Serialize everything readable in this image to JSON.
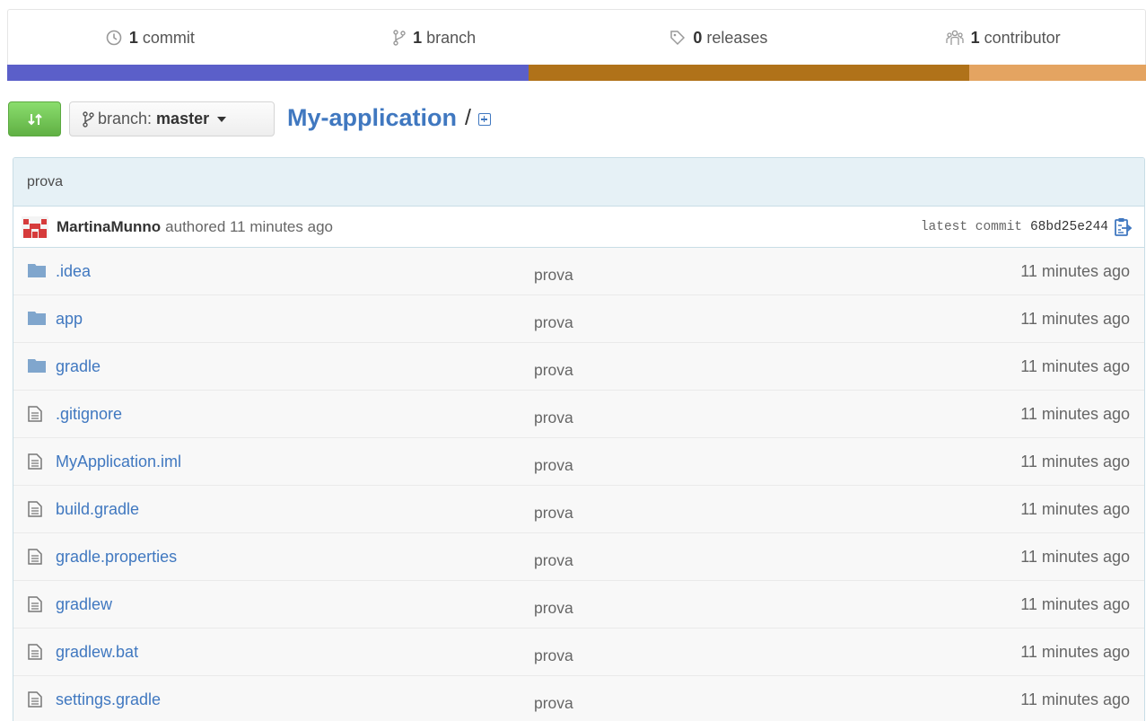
{
  "summary": {
    "commits": {
      "num": "1",
      "label": "commit"
    },
    "branches": {
      "num": "1",
      "label": "branch"
    },
    "releases": {
      "num": "0",
      "label": "releases"
    },
    "contributors": {
      "num": "1",
      "label": "contributor"
    }
  },
  "language_bar": {
    "colors": [
      "#5b5fc9",
      "#b07219",
      "#e4a461"
    ],
    "fractions": [
      0.458,
      0.387,
      0.155
    ]
  },
  "nav": {
    "branch_label": "branch:",
    "branch_name": "master",
    "repo_name": "My-application",
    "separator": "/"
  },
  "commit": {
    "message": "prova",
    "author": "MartinaMunno",
    "authored_text": "authored 11 minutes ago",
    "latest_label": "latest commit",
    "sha": "68bd25e244"
  },
  "files": [
    {
      "type": "directory",
      "name": ".idea",
      "message": "prova",
      "age": "11 minutes ago"
    },
    {
      "type": "directory",
      "name": "app",
      "message": "prova",
      "age": "11 minutes ago"
    },
    {
      "type": "directory",
      "name": "gradle",
      "message": "prova",
      "age": "11 minutes ago"
    },
    {
      "type": "file",
      "name": ".gitignore",
      "message": "prova",
      "age": "11 minutes ago"
    },
    {
      "type": "file",
      "name": "MyApplication.iml",
      "message": "prova",
      "age": "11 minutes ago"
    },
    {
      "type": "file",
      "name": "build.gradle",
      "message": "prova",
      "age": "11 minutes ago"
    },
    {
      "type": "file",
      "name": "gradle.properties",
      "message": "prova",
      "age": "11 minutes ago"
    },
    {
      "type": "file",
      "name": "gradlew",
      "message": "prova",
      "age": "11 minutes ago"
    },
    {
      "type": "file",
      "name": "gradlew.bat",
      "message": "prova",
      "age": "11 minutes ago"
    },
    {
      "type": "file",
      "name": "settings.gradle",
      "message": "prova",
      "age": "11 minutes ago"
    }
  ],
  "colors": {
    "link": "#4078c0",
    "commit_bg": "#e6f1f6",
    "row_bg": "#f8f8f8",
    "compare_green": "#60b044",
    "folder": "#80a6cd",
    "file_icon": "#777777"
  }
}
